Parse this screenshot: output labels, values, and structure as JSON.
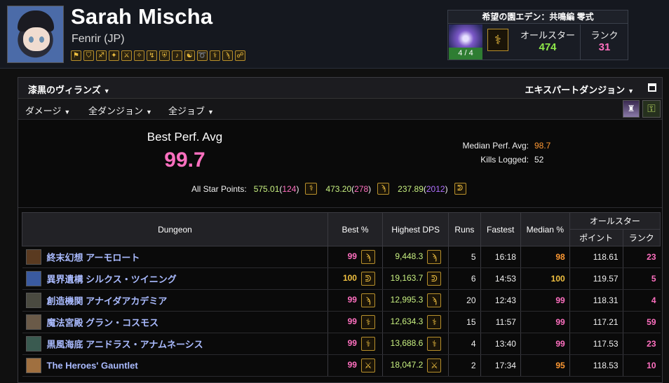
{
  "character": {
    "name": "Sarah Mischa",
    "server": "Fenrir (JP)",
    "job_icons": [
      "⚑",
      "⛉",
      "♐",
      "✦",
      "⚔",
      "✧",
      "↯",
      "⛨",
      "♪",
      "☯",
      "➰",
      "⚕",
      "ϡ",
      "☍"
    ]
  },
  "raid": {
    "title": "希望の園エデン：共鳴編 零式",
    "progress": "4 / 4",
    "job_glyph": "⚕",
    "allstar_label": "オールスター",
    "allstar_value": "474",
    "rank_label": "ランク",
    "rank_value": "31"
  },
  "panel": {
    "zone": "漆黒のヴィランズ",
    "difficulty": "エキスパートダンジョン",
    "filters": {
      "metric": "ダメージ",
      "dungeons": "全ダンジョン",
      "jobs": "全ジョブ"
    }
  },
  "summary": {
    "best_perf_label": "Best Perf. Avg",
    "best_perf_value": "99.7",
    "median_label": "Median Perf. Avg:",
    "median_value": "98.7",
    "kills_label": "Kills Logged:",
    "kills_value": "52",
    "allstar_label": "All Star Points:",
    "allstar_points": [
      {
        "points": "575.01",
        "rank": "124",
        "rank_color": "pink",
        "icon": "⚕"
      },
      {
        "points": "473.20",
        "rank": "278",
        "rank_color": "pink",
        "icon": "ϡ"
      },
      {
        "points": "237.89",
        "rank": "2012",
        "rank_color": "purple",
        "icon": "ᕲ"
      }
    ]
  },
  "table": {
    "headers": {
      "dungeon": "Dungeon",
      "best": "Best %",
      "dps": "Highest DPS",
      "runs": "Runs",
      "fastest": "Fastest",
      "median": "Median %",
      "allstar": "オールスター",
      "points": "ポイント",
      "rank": "ランク"
    },
    "rows": [
      {
        "name": "終末幻想 アーモロート",
        "thumb": "#5a3a20",
        "best": "99",
        "best_color": "pink",
        "icon": "ϡ",
        "dps": "9,448.3",
        "runs": "5",
        "fastest": "16:18",
        "median": "98",
        "median_color": "orange",
        "points": "118.61",
        "rank": "23"
      },
      {
        "name": "異界遺構 シルクス・ツイニング",
        "thumb": "#3a5aa0",
        "best": "100",
        "best_color": "gold",
        "icon": "ᕲ",
        "dps": "19,163.7",
        "runs": "6",
        "fastest": "14:53",
        "median": "100",
        "median_color": "gold",
        "points": "119.57",
        "rank": "5"
      },
      {
        "name": "創造機関 アナイダアカデミア",
        "thumb": "#4a4a40",
        "best": "99",
        "best_color": "pink",
        "icon": "ϡ",
        "dps": "12,995.3",
        "runs": "20",
        "fastest": "12:43",
        "median": "99",
        "median_color": "pink",
        "points": "118.31",
        "rank": "4"
      },
      {
        "name": "魔法宮殿 グラン・コスモス",
        "thumb": "#6a5a48",
        "best": "99",
        "best_color": "pink",
        "icon": "⚕",
        "dps": "12,634.3",
        "runs": "15",
        "fastest": "11:57",
        "median": "99",
        "median_color": "pink",
        "points": "117.21",
        "rank": "59"
      },
      {
        "name": "黒風海底 アニドラス・アナムネーシス",
        "thumb": "#3a5a50",
        "best": "99",
        "best_color": "pink",
        "icon": "⚕",
        "dps": "13,688.6",
        "runs": "4",
        "fastest": "13:40",
        "median": "99",
        "median_color": "pink",
        "points": "117.53",
        "rank": "23"
      },
      {
        "name": "The Heroes' Gauntlet",
        "thumb": "#a07040",
        "best": "99",
        "best_color": "pink",
        "icon": "⚔",
        "dps": "18,047.2",
        "runs": "2",
        "fastest": "17:34",
        "median": "95",
        "median_color": "orange",
        "points": "118.53",
        "rank": "10"
      }
    ]
  },
  "colors": {
    "pink": "#ff70c0",
    "orange": "#ff9933",
    "gold": "#f0c040",
    "purple": "#b070ff",
    "green": "#c8f080",
    "link": "#aabbff"
  }
}
